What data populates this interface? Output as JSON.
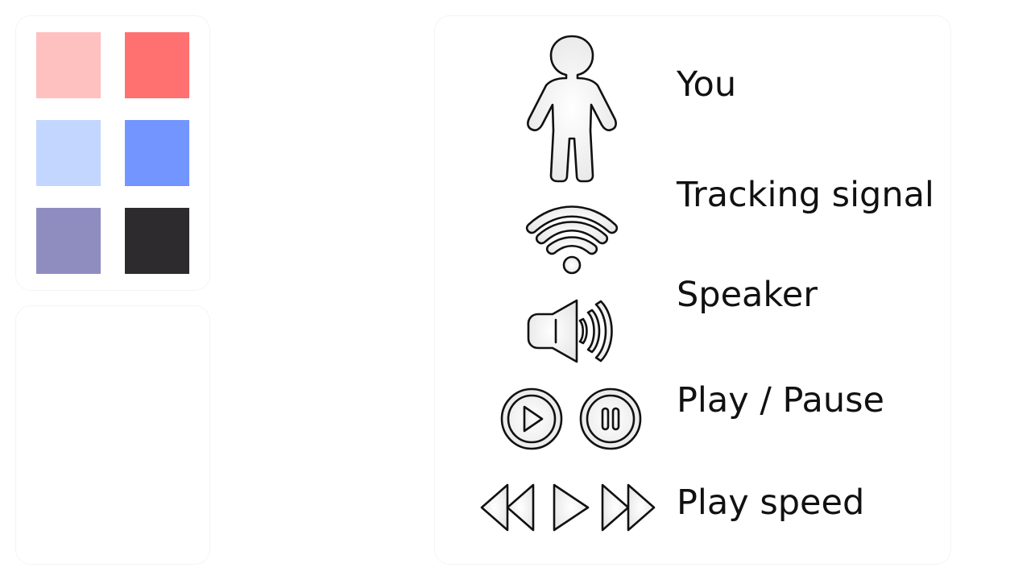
{
  "palette": {
    "swatches": [
      {
        "name": "light-red",
        "color": "#ffc0c0"
      },
      {
        "name": "red",
        "color": "#ff7070"
      },
      {
        "name": "light-blue",
        "color": "#c2d6ff"
      },
      {
        "name": "blue",
        "color": "#7395ff"
      },
      {
        "name": "lavender",
        "color": "#8f8dc0"
      },
      {
        "name": "near-black",
        "color": "#2d2b2d"
      }
    ]
  },
  "legend": {
    "items": [
      {
        "icon": "person-icon",
        "label": "You"
      },
      {
        "icon": "signal-icon",
        "label": "Tracking signal"
      },
      {
        "icon": "speaker-icon",
        "label": "Speaker"
      },
      {
        "icon": "play-pause-icons",
        "label": "Play / Pause"
      },
      {
        "icon": "play-speed-icons",
        "label": "Play speed"
      }
    ]
  }
}
